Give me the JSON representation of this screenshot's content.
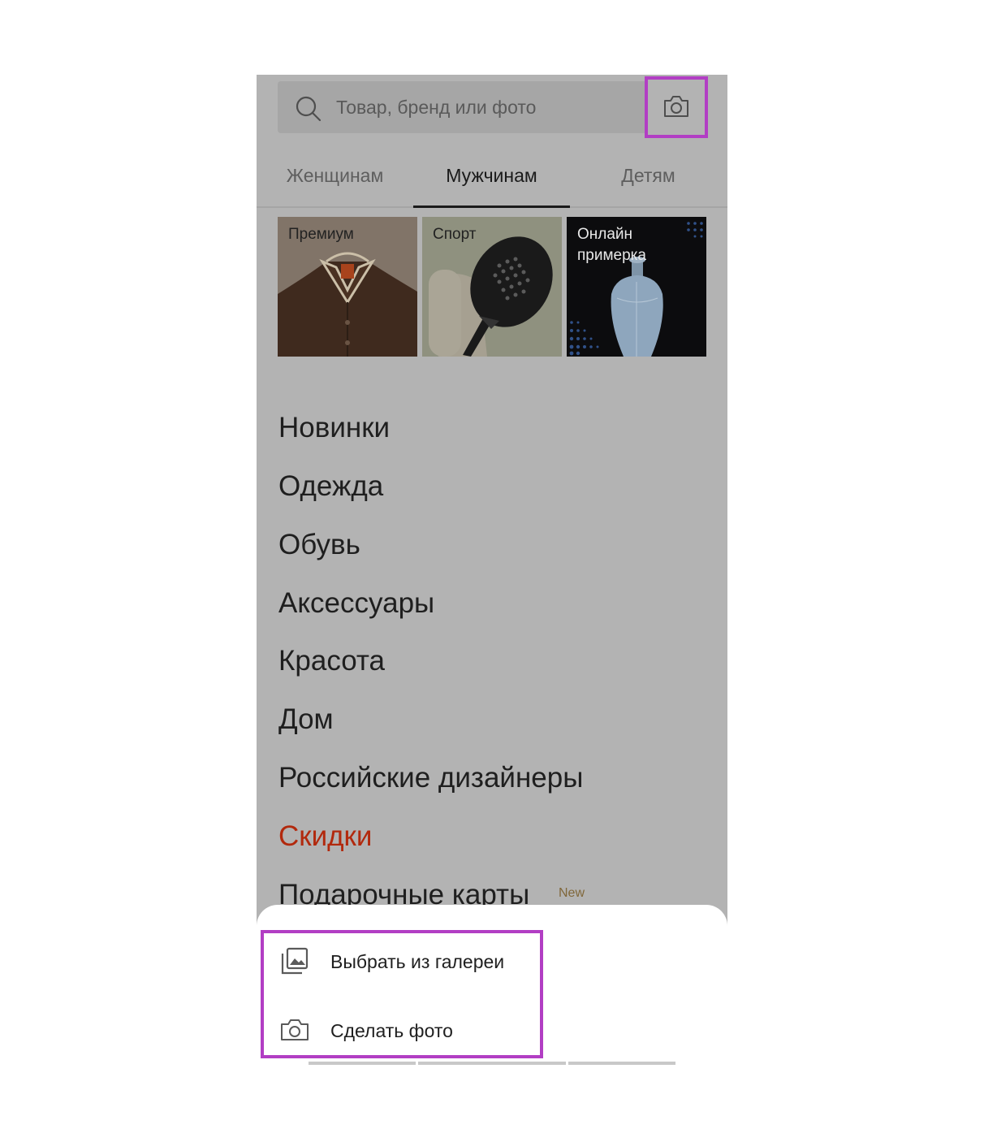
{
  "search": {
    "placeholder": "Товар, бренд или фото",
    "icon": "search-icon",
    "camera_icon": "camera-icon"
  },
  "tabs": [
    {
      "label": "Женщинам",
      "active": false
    },
    {
      "label": "Мужчинам",
      "active": true
    },
    {
      "label": "Детям",
      "active": false
    }
  ],
  "tiles": [
    {
      "label": "Премиум"
    },
    {
      "label": "Спорт"
    },
    {
      "label": "Онлайн примерка"
    }
  ],
  "menu": {
    "items": [
      "Новинки",
      "Одежда",
      "Обувь",
      "Аксессуары",
      "Красота",
      "Дом",
      "Российские дизайнеры",
      "Скидки",
      "Подарочные карты"
    ],
    "new_badge": "New"
  },
  "sheet": {
    "gallery_label": "Выбрать из галереи",
    "photo_label": "Сделать фото",
    "gallery_icon": "gallery-icon",
    "photo_icon": "camera-icon"
  },
  "colors": {
    "highlight": "#b23ec4",
    "sale": "#b2290d",
    "overlay": "#b3b3b3"
  }
}
